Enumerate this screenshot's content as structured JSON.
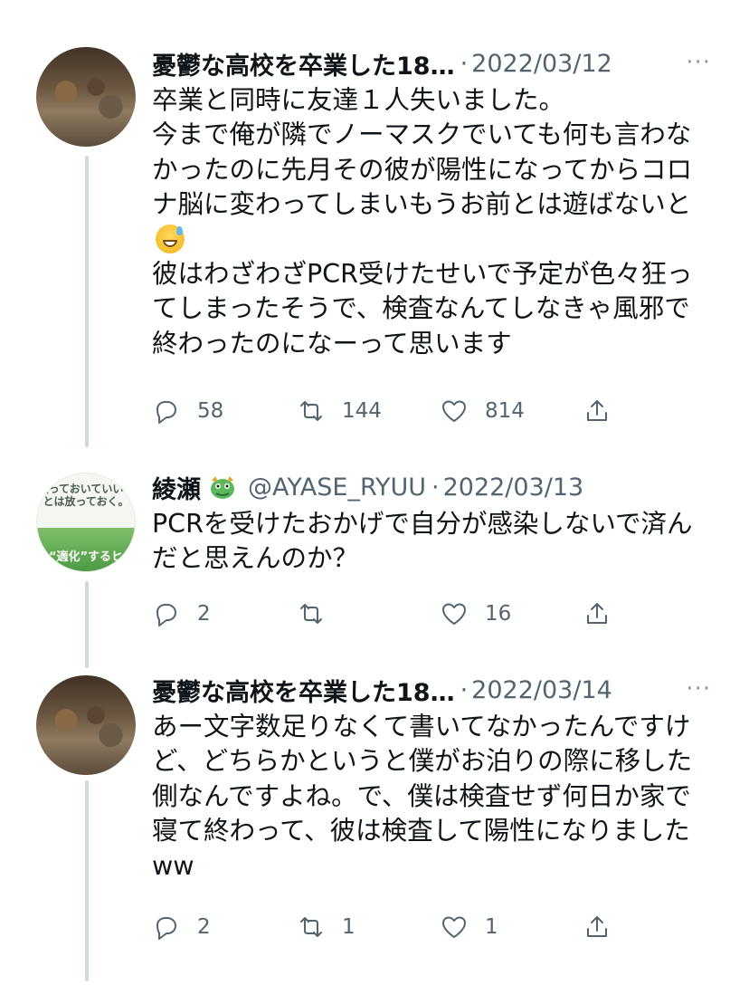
{
  "tweets": [
    {
      "name": "憂鬱な高校を卒業した18…",
      "handle": "",
      "date": "2022/03/12",
      "body_before_emoji": "卒業と同時に友達１人失いました。\n今まで俺が隣でノーマスクでいても何も言わなかったのに先月その彼が陽性になってからコロナ脳に変わってしまいもうお前とは遊ばないと",
      "emoji": "grinning-sweat-emoji",
      "body_after_emoji": "\n彼はわざわざPCR受けたせいで予定が色々狂ってしまったそうで、検査なんてしなきゃ風邪で終わったのになーって思います",
      "replies": "58",
      "retweets": "144",
      "likes": "814"
    },
    {
      "name": "綾瀬",
      "handle": "@AYASE_RYUU",
      "date": "2022/03/13",
      "body": "PCRを受けたおかげで自分が感染しないで済んだと思えんのか？",
      "name_emoji": "dragon-face-emoji",
      "replies": "2",
      "retweets": "",
      "likes": "16",
      "avatar_text": "放っておいていいことは放っておく。",
      "avatar_band_text": "“適化”するヒ"
    },
    {
      "name": "憂鬱な高校を卒業した18…",
      "handle": "",
      "date": "2022/03/14",
      "body": "あー文字数足りなくて書いてなかったんですけど、どちらかというと僕がお泊りの際に移した側なんですよね。で、僕は検査せず何日か家で寝て終わって、彼は検査して陽性になりましたww",
      "replies": "2",
      "retweets": "1",
      "likes": "1"
    }
  ],
  "more_label": "···",
  "separator": "·",
  "colors": {
    "text": "#0f1419",
    "secondary": "#536471",
    "thread_line": "#cfd9de"
  }
}
